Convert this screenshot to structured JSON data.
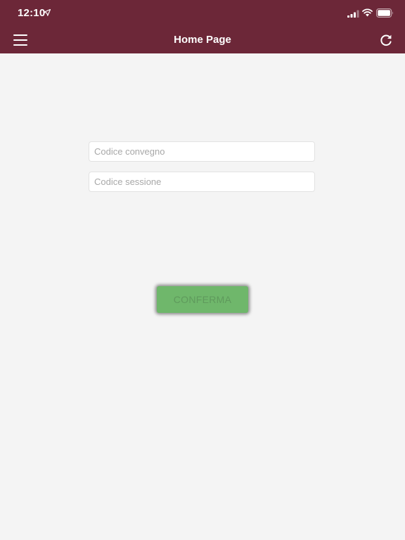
{
  "status_bar": {
    "time": "12:10",
    "icons": [
      "location-arrow-icon",
      "signal-icon",
      "wifi-icon",
      "battery-icon"
    ]
  },
  "header": {
    "title": "Home Page",
    "left_icon": "hamburger-menu-icon",
    "right_icon": "refresh-icon",
    "background_color": "#6c2738"
  },
  "form": {
    "convegno_placeholder": "Codice convegno",
    "convegno_value": "",
    "sessione_placeholder": "Codice sessione",
    "sessione_value": ""
  },
  "actions": {
    "confirm_label": "CONFERMA",
    "confirm_color": "#6fb76b"
  }
}
